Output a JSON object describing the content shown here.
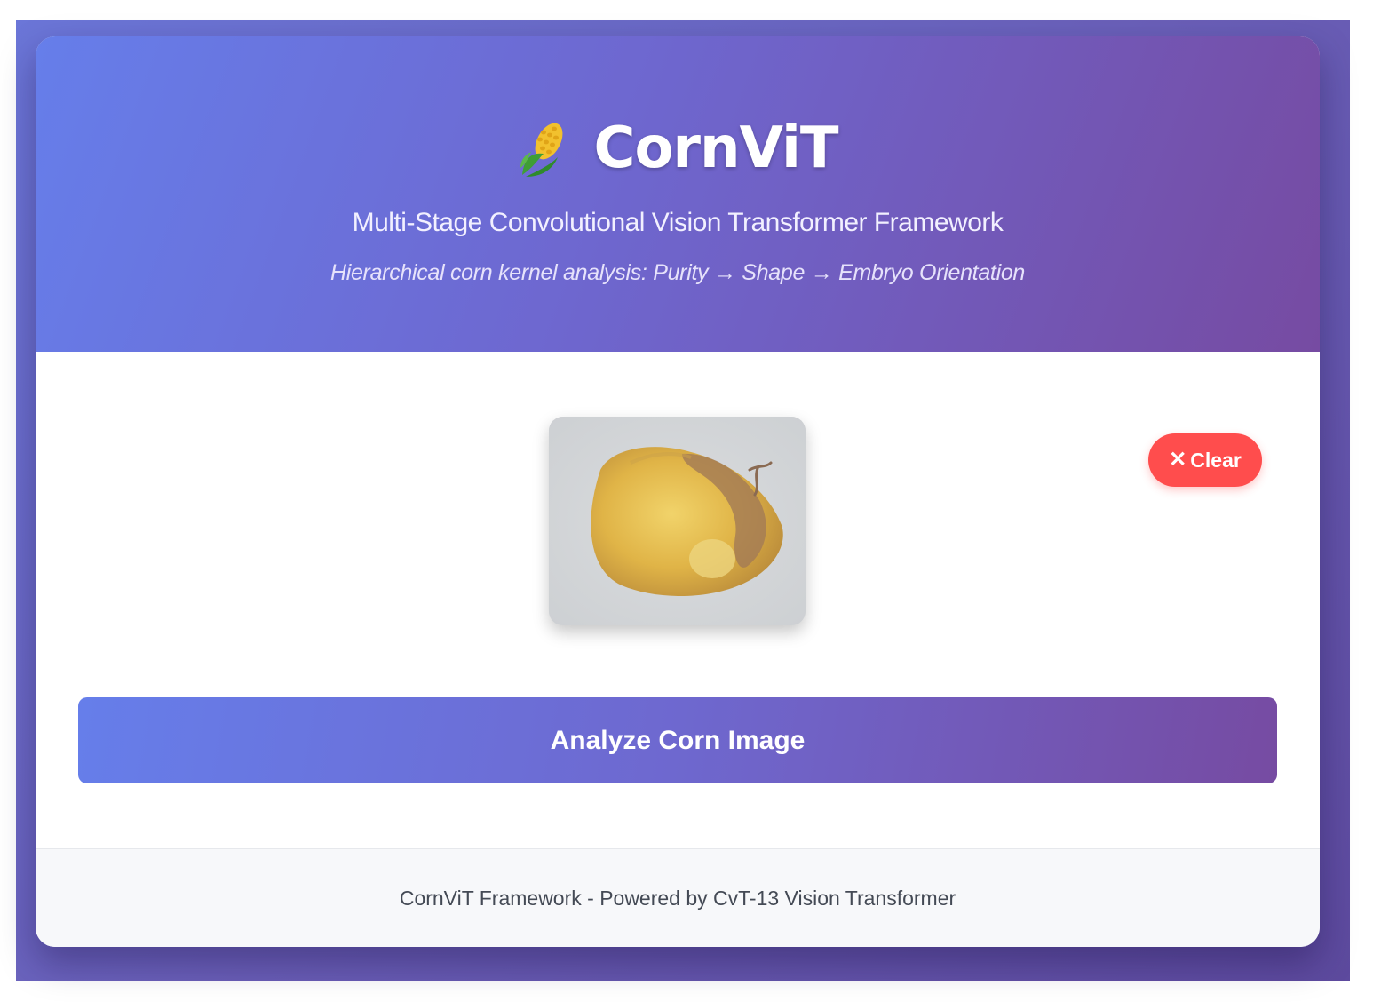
{
  "header": {
    "title": "CornViT",
    "subtitle": "Multi-Stage Convolutional Vision Transformer Framework",
    "tagline": "Hierarchical corn kernel analysis: Purity → Shape → Embryo Orientation",
    "logo_icon": "corn-icon"
  },
  "upload": {
    "preview_alt": "corn kernel image",
    "clear_icon": "close-icon",
    "clear_label": "Clear"
  },
  "actions": {
    "analyze_label": "Analyze Corn Image"
  },
  "footer": {
    "text": "CornViT Framework - Powered by CvT-13 Vision Transformer"
  },
  "colors": {
    "accent_start": "#667eea",
    "accent_end": "#764ba2",
    "clear_button": "#ff4d4d"
  }
}
